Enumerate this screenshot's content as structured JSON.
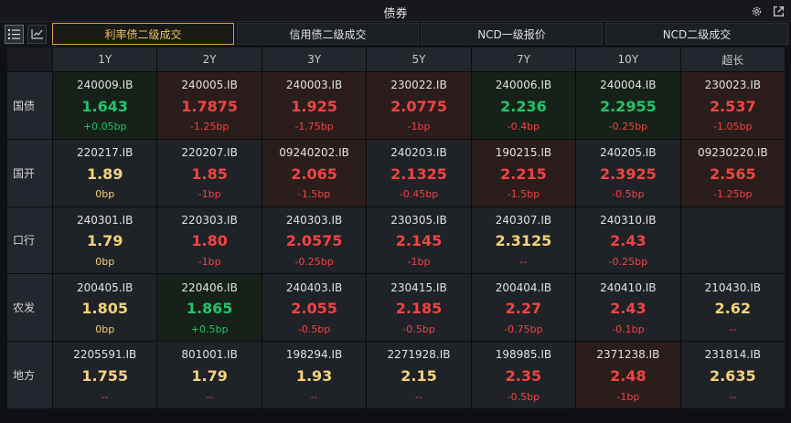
{
  "window": {
    "title": "债券"
  },
  "colors": {
    "up": "#f04444",
    "down": "#1fc46a",
    "flat": "#f4d37a",
    "accent": "#d9a441"
  },
  "toolbar": {
    "view_buttons": [
      {
        "name": "list-view-button",
        "icon": "list-icon",
        "active": true
      },
      {
        "name": "chart-view-button",
        "icon": "line-chart-icon",
        "active": false
      }
    ],
    "tabs": [
      {
        "label": "利率债二级成交",
        "active": true
      },
      {
        "label": "信用债二级成交",
        "active": false
      },
      {
        "label": "NCD一级报价",
        "active": false
      },
      {
        "label": "NCD二级成交",
        "active": false
      }
    ]
  },
  "table": {
    "columns": [
      "1Y",
      "2Y",
      "3Y",
      "5Y",
      "7Y",
      "10Y",
      "超长"
    ],
    "rows": [
      {
        "label": "国债",
        "cells": [
          {
            "code": "240009.IB",
            "yield": "1.643",
            "change": "+0.05bp",
            "dir": "down"
          },
          {
            "code": "240005.IB",
            "yield": "1.7875",
            "change": "-1.25bp",
            "dir": "up"
          },
          {
            "code": "240003.IB",
            "yield": "1.925",
            "change": "-1.75bp",
            "dir": "up"
          },
          {
            "code": "230022.IB",
            "yield": "2.0775",
            "change": "-1bp",
            "dir": "up"
          },
          {
            "code": "240006.IB",
            "yield": "2.236",
            "change": "-0.4bp",
            "dir": "down"
          },
          {
            "code": "240004.IB",
            "yield": "2.2955",
            "change": "-0.25bp",
            "dir": "down"
          },
          {
            "code": "230023.IB",
            "yield": "2.537",
            "change": "-1.05bp",
            "dir": "up"
          }
        ]
      },
      {
        "label": "国开",
        "cells": [
          {
            "code": "220217.IB",
            "yield": "1.89",
            "change": "0bp",
            "dir": "flat"
          },
          {
            "code": "220207.IB",
            "yield": "1.85",
            "change": "-1bp",
            "dir": "neutral"
          },
          {
            "code": "09240202.IB",
            "yield": "2.065",
            "change": "-1.5bp",
            "dir": "up"
          },
          {
            "code": "240203.IB",
            "yield": "2.1325",
            "change": "-0.45bp",
            "dir": "neutral"
          },
          {
            "code": "190215.IB",
            "yield": "2.215",
            "change": "-1.5bp",
            "dir": "up"
          },
          {
            "code": "240205.IB",
            "yield": "2.3925",
            "change": "-0.5bp",
            "dir": "neutral"
          },
          {
            "code": "09230220.IB",
            "yield": "2.565",
            "change": "-1.25bp",
            "dir": "up"
          }
        ]
      },
      {
        "label": "口行",
        "cells": [
          {
            "code": "240301.IB",
            "yield": "1.79",
            "change": "0bp",
            "dir": "flat"
          },
          {
            "code": "220303.IB",
            "yield": "1.80",
            "change": "-1bp",
            "dir": "neutral"
          },
          {
            "code": "240303.IB",
            "yield": "2.0575",
            "change": "-0.25bp",
            "dir": "neutral"
          },
          {
            "code": "230305.IB",
            "yield": "2.145",
            "change": "-1bp",
            "dir": "neutral"
          },
          {
            "code": "240307.IB",
            "yield": "2.3125",
            "change": "--",
            "dir": "flat"
          },
          {
            "code": "240310.IB",
            "yield": "2.43",
            "change": "-0.25bp",
            "dir": "neutral"
          },
          {
            "code": "",
            "yield": "",
            "change": "",
            "dir": "empty"
          }
        ]
      },
      {
        "label": "农发",
        "cells": [
          {
            "code": "200405.IB",
            "yield": "1.805",
            "change": "0bp",
            "dir": "flat"
          },
          {
            "code": "220406.IB",
            "yield": "1.865",
            "change": "+0.5bp",
            "dir": "down"
          },
          {
            "code": "240403.IB",
            "yield": "2.055",
            "change": "-0.5bp",
            "dir": "neutral"
          },
          {
            "code": "230415.IB",
            "yield": "2.185",
            "change": "-0.5bp",
            "dir": "neutral"
          },
          {
            "code": "200404.IB",
            "yield": "2.27",
            "change": "-0.75bp",
            "dir": "neutral"
          },
          {
            "code": "240410.IB",
            "yield": "2.43",
            "change": "-0.1bp",
            "dir": "neutral"
          },
          {
            "code": "210430.IB",
            "yield": "2.62",
            "change": "--",
            "dir": "flat"
          }
        ]
      },
      {
        "label": "地方",
        "cells": [
          {
            "code": "2205591.IB",
            "yield": "1.755",
            "change": "--",
            "dir": "flat"
          },
          {
            "code": "801001.IB",
            "yield": "1.79",
            "change": "--",
            "dir": "flat"
          },
          {
            "code": "198294.IB",
            "yield": "1.93",
            "change": "--",
            "dir": "flat"
          },
          {
            "code": "2271928.IB",
            "yield": "2.15",
            "change": "--",
            "dir": "flat"
          },
          {
            "code": "198985.IB",
            "yield": "2.35",
            "change": "-0.5bp",
            "dir": "neutral"
          },
          {
            "code": "2371238.IB",
            "yield": "2.48",
            "change": "-1bp",
            "dir": "up"
          },
          {
            "code": "231814.IB",
            "yield": "2.635",
            "change": "--",
            "dir": "flat"
          }
        ]
      }
    ]
  }
}
